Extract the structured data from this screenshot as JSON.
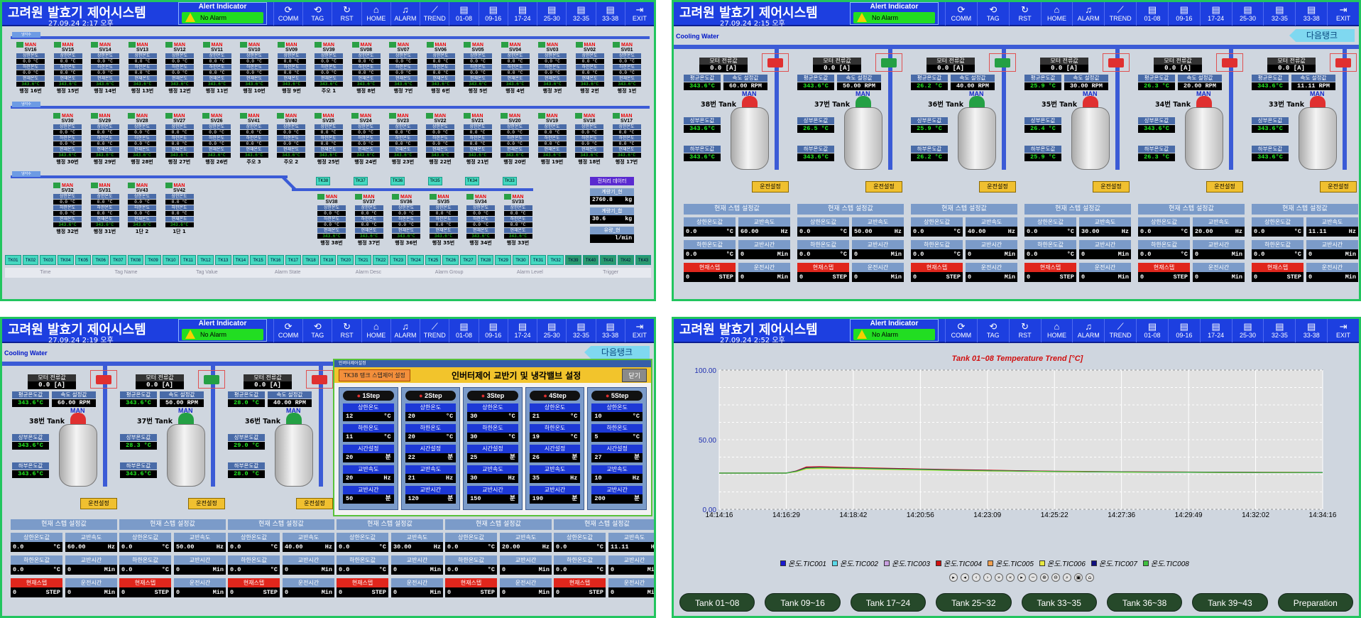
{
  "app_title": "고려원 발효기 제어시스템",
  "alert": {
    "label": "Alert Indicator",
    "status": "No Alarm"
  },
  "nav": [
    "COMM",
    "TAG",
    "RST",
    "HOME",
    "ALARM",
    "TREND",
    "01-08",
    "09-16",
    "17-24",
    "25-30",
    "32-35",
    "33-38",
    "EXIT"
  ],
  "panels": {
    "p1": {
      "date": "27.09.24 2:17 오후"
    },
    "p2": {
      "date": "27.09.24 2:15 오후",
      "section": "Cooling Water",
      "next_button": "다음탱크"
    },
    "p3": {
      "date": "27.09.24 2:19 오후",
      "section": "Cooling Water",
      "next_button": "다음탱크"
    },
    "p4": {
      "date": "27.09.24 2:52 오후"
    }
  },
  "overview": {
    "sections": [
      "냉각수",
      "냉각수",
      "냉각수"
    ],
    "row1": [
      {
        "sv": "SV16",
        "name": "행정 16번"
      },
      {
        "sv": "SV15",
        "name": "행정 15번"
      },
      {
        "sv": "SV14",
        "name": "행정 14번"
      },
      {
        "sv": "SV13",
        "name": "행정 13번"
      },
      {
        "sv": "SV12",
        "name": "행정 12번"
      },
      {
        "sv": "SV11",
        "name": "행정 11번"
      },
      {
        "sv": "SV10",
        "name": "행정 10번"
      },
      {
        "sv": "SV09",
        "name": "행정 9번"
      },
      {
        "sv": "SV39",
        "name": "주오 1"
      },
      {
        "sv": "SV08",
        "name": "행정 8번"
      },
      {
        "sv": "SV07",
        "name": "행정 7번"
      },
      {
        "sv": "SV06",
        "name": "행정 6번"
      },
      {
        "sv": "SV05",
        "name": "행정 5번"
      },
      {
        "sv": "SV04",
        "name": "행정 4번"
      },
      {
        "sv": "SV03",
        "name": "행정 3번"
      },
      {
        "sv": "SV02",
        "name": "행정 2번"
      },
      {
        "sv": "SV01",
        "name": "행정 1번"
      }
    ],
    "row2": [
      {
        "sv": "SV30",
        "name": "행정 30번"
      },
      {
        "sv": "SV29",
        "name": "행정 29번"
      },
      {
        "sv": "SV28",
        "name": "행정 28번"
      },
      {
        "sv": "SV27",
        "name": "행정 27번"
      },
      {
        "sv": "SV26",
        "name": "행정 26번"
      },
      {
        "sv": "SV41",
        "name": "주오 3"
      },
      {
        "sv": "SV40",
        "name": "주오 2"
      },
      {
        "sv": "SV25",
        "name": "행정 25번"
      },
      {
        "sv": "SV24",
        "name": "행정 24번"
      },
      {
        "sv": "SV23",
        "name": "행정 23번"
      },
      {
        "sv": "SV22",
        "name": "행정 22번"
      },
      {
        "sv": "SV21",
        "name": "행정 21번"
      },
      {
        "sv": "SV20",
        "name": "행정 20번"
      },
      {
        "sv": "SV19",
        "name": "행정 19번"
      },
      {
        "sv": "SV18",
        "name": "행정 18번"
      },
      {
        "sv": "SV17",
        "name": "행정 17번"
      }
    ],
    "row3a": [
      {
        "sv": "SV32",
        "name": "행정 32번"
      },
      {
        "sv": "SV31",
        "name": "행정 31번"
      },
      {
        "sv": "SV43",
        "name": "1단 2"
      },
      {
        "sv": "SV42",
        "name": "1단 1"
      }
    ],
    "row3b": [
      {
        "sv": "SV38",
        "name": "행정 38번"
      },
      {
        "sv": "SV37",
        "name": "행정 37번"
      },
      {
        "sv": "SV36",
        "name": "행정 36번"
      },
      {
        "sv": "SV35",
        "name": "행정 35번"
      },
      {
        "sv": "SV34",
        "name": "행정 34번"
      },
      {
        "sv": "SV33",
        "name": "행정 33번"
      }
    ],
    "tk_labels": [
      "TK38",
      "TK37",
      "TK36",
      "TK35",
      "TK34",
      "TK33"
    ],
    "cell": {
      "man": "MAN",
      "lbl_up": "상한온도",
      "val": "0.0 °C",
      "lbl_dn": "하한온도",
      "lbl_cur": "현재온도",
      "cur": "343.6°C"
    },
    "side": {
      "header": "전처리 데이터",
      "l1": "계량기_현",
      "v1": "2760.8",
      "u1": "kg",
      "l2": "계량기_합",
      "v2": "30.6",
      "u2": "kg",
      "l3": "유량_현",
      "v3": "",
      "u3": "l/min"
    },
    "tk_bar": [
      "TK01",
      "TK02",
      "TK03",
      "TK04",
      "TK05",
      "TK06",
      "TK07",
      "TK08",
      "TK09",
      "TK10",
      "TK11",
      "TK12",
      "TK13",
      "TK14",
      "TK15",
      "TK16",
      "TK17",
      "TK18",
      "TK19",
      "TK20",
      "TK21",
      "TK22",
      "TK23",
      "TK24",
      "TK25",
      "TK26",
      "TK27",
      "TK28",
      "TK29",
      "TK30",
      "TK31",
      "TK32",
      "TK39",
      "TK40",
      "TK41",
      "TK42",
      "TK43"
    ],
    "alarm_cols": [
      "Time",
      "Tag Name",
      "Tag Value",
      "Alarm State",
      "Alarm Desc",
      "Alarm Group",
      "Alarm Level",
      "Trigger"
    ]
  },
  "tank_labels": {
    "motor_current": "모터 전류값",
    "amp_unit": "[A]",
    "avg_temp": "평균온도값",
    "speed_set": "속도 설정값",
    "upper_temp": "상부온도값",
    "lower_temp": "하부온도값",
    "operate_btn": "운전설정",
    "man": "MAN",
    "step_header": "현재 스텝 설정값",
    "sp_upper": "상한온도값",
    "sp_speed": "교반속도",
    "sp_lower": "하한온도값",
    "sp_stirtime": "교반시간",
    "sp_curstep": "현재스텝",
    "sp_runtime": "운전시간",
    "u_c": "°C",
    "u_hz": "Hz",
    "u_min": "Min",
    "u_step": "STEP"
  },
  "tanks_p2": [
    {
      "name": "38번 Tank",
      "amp": "0.0",
      "avg": "343.6°C",
      "speed": "60.00 RPM",
      "upper": "343.6°C",
      "lower": "343.6°C",
      "sp_up": "0.0",
      "sp_speed": "60.00",
      "sp_lo": "0.0",
      "stir": "0",
      "step": "0",
      "run": "0",
      "cap": "#e03030",
      "valve": "#e03030"
    },
    {
      "name": "37번 Tank",
      "amp": "0.0",
      "avg": "343.6°C",
      "speed": "50.00 RPM",
      "upper": "26.5 °C",
      "lower": "343.6°C",
      "sp_up": "0.0",
      "sp_speed": "50.00",
      "sp_lo": "0.0",
      "stir": "0",
      "step": "0",
      "run": "0",
      "cap": "#24a044",
      "valve": "#24a044"
    },
    {
      "name": "36번 Tank",
      "amp": "0.0",
      "avg": "26.2 °C",
      "speed": "40.00 RPM",
      "upper": "25.9 °C",
      "lower": "26.2 °C",
      "sp_up": "0.0",
      "sp_speed": "40.00",
      "sp_lo": "0.0",
      "stir": "0",
      "step": "0",
      "run": "0",
      "cap": "#24a044",
      "valve": "#24a044"
    },
    {
      "name": "35번 Tank",
      "amp": "0.0",
      "avg": "25.9 °C",
      "speed": "30.00 RPM",
      "upper": "26.4 °C",
      "lower": "25.9 °C",
      "sp_up": "0.0",
      "sp_speed": "30.00",
      "sp_lo": "0.0",
      "stir": "0",
      "step": "0",
      "run": "0",
      "cap": "#e03030",
      "valve": "#e03030"
    },
    {
      "name": "34번 Tank",
      "amp": "0.0",
      "avg": "26.3 °C",
      "speed": "20.00 RPM",
      "upper": "343.6°C",
      "lower": "26.3 °C",
      "sp_up": "0.0",
      "sp_speed": "20.00",
      "sp_lo": "0.0",
      "stir": "0",
      "step": "0",
      "run": "0",
      "cap": "#e03030",
      "valve": "#e03030"
    },
    {
      "name": "33번 Tank",
      "amp": "0.0",
      "avg": "343.6°C",
      "speed": "11.11 RPM",
      "upper": "343.6°C",
      "lower": "343.6°C",
      "sp_up": "0.0",
      "sp_speed": "11.11",
      "sp_lo": "0.0",
      "stir": "0",
      "step": "0",
      "run": "0",
      "cap": "#e03030",
      "valve": "#e03030"
    }
  ],
  "tanks_p3": [
    {
      "name": "38번 Tank",
      "amp": "0.0",
      "avg": "343.6°C",
      "speed": "60.00 RPM",
      "upper": "343.6°C",
      "lower": "343.6°C",
      "cap": "#e03030",
      "valve": "#e03030"
    },
    {
      "name": "37번 Tank",
      "amp": "0.0",
      "avg": "343.6°C",
      "speed": "50.00 RPM",
      "upper": "28.3 °C",
      "lower": "343.6°C",
      "cap": "#24a044",
      "valve": "#24a044"
    },
    {
      "name": "36번 Tank",
      "amp": "0.0",
      "avg": "28.0 °C",
      "speed": "40.00 RPM",
      "upper": "29.0 °C",
      "lower": "28.0 °C",
      "cap": "#24a044",
      "valve": "#e03030"
    }
  ],
  "sp_p3": [
    {
      "sp_up": "0.0",
      "sp_speed": "60.00",
      "sp_lo": "0.0",
      "stir": "0",
      "step": "0",
      "run": "0"
    },
    {
      "sp_up": "0.0",
      "sp_speed": "50.00",
      "sp_lo": "0.0",
      "stir": "0",
      "step": "0",
      "run": "0"
    },
    {
      "sp_up": "0.0",
      "sp_speed": "40.00",
      "sp_lo": "0.0",
      "stir": "0",
      "step": "0",
      "run": "0"
    },
    {
      "sp_up": "0.0",
      "sp_speed": "30.00",
      "sp_lo": "0.0",
      "stir": "0",
      "step": "0",
      "run": "0"
    },
    {
      "sp_up": "0.0",
      "sp_speed": "20.00",
      "sp_lo": "0.0",
      "stir": "0",
      "step": "0",
      "run": "0"
    },
    {
      "sp_up": "0.0",
      "sp_speed": "11.11",
      "sp_lo": "0.0",
      "stir": "0",
      "step": "0",
      "run": "0"
    }
  ],
  "dialog": {
    "window_title": "인버터제어설정",
    "tag": "TK38 탱크 스텝제어 설정",
    "title": "인버터제어 교반기 및 냉각밸브 설정",
    "close": "닫기",
    "labels": {
      "up": "상한온도",
      "dn": "하한온도",
      "time": "시간설정",
      "speed": "교반속도",
      "stirtime": "교반시간"
    },
    "units": {
      "c": "°C",
      "min": "분",
      "hz": "Hz"
    },
    "steps": [
      {
        "name": "1Step",
        "up": "12",
        "dn": "11",
        "time": "20",
        "speed": "20",
        "stir": "50"
      },
      {
        "name": "2Step",
        "up": "20",
        "dn": "20",
        "time": "22",
        "speed": "21",
        "stir": "120"
      },
      {
        "name": "3Step",
        "up": "30",
        "dn": "30",
        "time": "25",
        "speed": "30",
        "stir": "150"
      },
      {
        "name": "4Step",
        "up": "21",
        "dn": "19",
        "time": "26",
        "speed": "35",
        "stir": "190"
      },
      {
        "name": "5Step",
        "up": "10",
        "dn": "5",
        "time": "27",
        "speed": "10",
        "stir": "200"
      }
    ]
  },
  "trend": {
    "tank_buttons": [
      "Tank  01~08",
      "Tank  09~16",
      "Tank  17~24",
      "Tank  25~32",
      "Tank  33~35",
      "Tank  36~38",
      "Tank  39~43",
      "Preparation"
    ]
  },
  "chart_data": {
    "type": "line",
    "title": "Tank 01~08 Temperature Trend [°C]",
    "ylim": [
      0,
      100
    ],
    "y_ticks": [
      "100.00",
      "50.00",
      "0.00"
    ],
    "x_ticks": [
      "14:14:16",
      "14:16:29",
      "14:18:42",
      "14:20:56",
      "14:23:09",
      "14:25:22",
      "14:27:36",
      "14:29:49",
      "14:32:02",
      "14:34:16"
    ],
    "grid": true,
    "legend_position": "bottom",
    "x": [
      0,
      1,
      2,
      2.3,
      2.6,
      3,
      4,
      5,
      6,
      7,
      8,
      9,
      10,
      11,
      12,
      13,
      14,
      15,
      16,
      17,
      18
    ],
    "series": [
      {
        "name": "온도.TIC001",
        "color": "#1a1ad0",
        "values": [
          26,
          26,
          26,
          27.5,
          30,
          30.2,
          29.8,
          29.3,
          28.8,
          28.3,
          27.9,
          27.6,
          27.3,
          27.1,
          26.9,
          26.8,
          26.7,
          26.6,
          26.6,
          26.5,
          26.5
        ]
      },
      {
        "name": "온도.TIC002",
        "color": "#5ad8e8",
        "values": [
          26,
          26,
          26,
          27.3,
          29.6,
          29.9,
          29.5,
          29.0,
          28.6,
          28.1,
          27.7,
          27.4,
          27.2,
          27.0,
          26.8,
          26.7,
          26.6,
          26.6,
          26.5,
          26.5,
          26.4
        ]
      },
      {
        "name": "온도.TIC003",
        "color": "#c8a0e0",
        "values": [
          26,
          26,
          26,
          27.2,
          29.4,
          29.7,
          29.3,
          28.9,
          28.5,
          28.0,
          27.7,
          27.4,
          27.1,
          26.9,
          26.8,
          26.7,
          26.6,
          26.5,
          26.5,
          26.4,
          26.4
        ]
      },
      {
        "name": "온도.TIC004",
        "color": "#d01010",
        "values": [
          26,
          26,
          26,
          27.6,
          30.4,
          30.6,
          30.0,
          29.5,
          29.0,
          28.5,
          28.1,
          27.7,
          27.4,
          27.2,
          27.0,
          26.9,
          26.8,
          26.7,
          26.6,
          26.6,
          26.5
        ]
      },
      {
        "name": "온도.TIC005",
        "color": "#f0a050",
        "values": [
          26,
          26,
          26,
          27.1,
          29.2,
          29.5,
          29.1,
          28.7,
          28.3,
          27.9,
          27.6,
          27.3,
          27.1,
          26.9,
          26.8,
          26.7,
          26.6,
          26.5,
          26.5,
          26.4,
          26.4
        ]
      },
      {
        "name": "온도.TIC006",
        "color": "#e8e840",
        "values": [
          26,
          26,
          26,
          27.0,
          29.0,
          29.3,
          29.0,
          28.6,
          28.2,
          27.8,
          27.5,
          27.3,
          27.0,
          26.9,
          26.7,
          26.6,
          26.6,
          26.5,
          26.4,
          26.4,
          26.4
        ]
      },
      {
        "name": "온도.TIC007",
        "color": "#101080",
        "values": [
          26,
          26,
          26,
          27.4,
          29.8,
          30.0,
          29.6,
          29.1,
          28.7,
          28.2,
          27.8,
          27.5,
          27.2,
          27.0,
          26.9,
          26.7,
          26.7,
          26.6,
          26.5,
          26.5,
          26.5
        ]
      },
      {
        "name": "온도.TIC008",
        "color": "#40c040",
        "values": [
          26,
          26,
          26,
          27.2,
          29.5,
          29.8,
          29.4,
          28.9,
          28.5,
          28.0,
          27.7,
          27.4,
          27.2,
          27.0,
          26.8,
          26.7,
          26.6,
          26.5,
          26.5,
          26.5,
          26.4
        ]
      }
    ]
  }
}
